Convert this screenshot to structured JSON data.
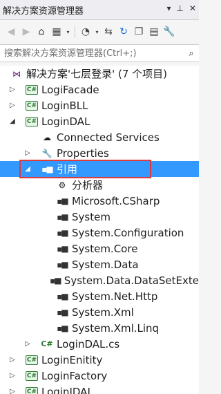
{
  "window": {
    "title": "解决方案资源管理器"
  },
  "toolbar": {
    "buttons": [
      "back-icon",
      "forward-icon",
      "home-icon",
      "switch-views-icon",
      "pending-changes-icon",
      "sync-icon",
      "refresh-icon",
      "collapse-all-icon",
      "show-all-files-icon",
      "properties-icon"
    ]
  },
  "search": {
    "placeholder": "搜索解决方案资源管理器(Ctrl+;)"
  },
  "tree": {
    "solution": "解决方案'七层登录' (7 个项目)",
    "items": [
      {
        "label": "LogiFacade"
      },
      {
        "label": "LoginBLL"
      },
      {
        "label": "LoginDAL"
      },
      {
        "label": "Connected Services"
      },
      {
        "label": "Properties"
      },
      {
        "label": "引用"
      },
      {
        "label": "分析器"
      },
      {
        "label": "Microsoft.CSharp"
      },
      {
        "label": "System"
      },
      {
        "label": "System.Configuration"
      },
      {
        "label": "System.Core"
      },
      {
        "label": "System.Data"
      },
      {
        "label": "System.Data.DataSetExte"
      },
      {
        "label": "System.Net.Http"
      },
      {
        "label": "System.Xml"
      },
      {
        "label": "System.Xml.Linq"
      },
      {
        "label": "LoginDAL.cs"
      },
      {
        "label": "LoginEnitity"
      },
      {
        "label": "LoginFactory"
      },
      {
        "label": "LoginIDAL"
      }
    ]
  },
  "colors": {
    "selection": "#3399ff",
    "annotation": "#e03a3a",
    "csharp": "#2e7d32"
  }
}
